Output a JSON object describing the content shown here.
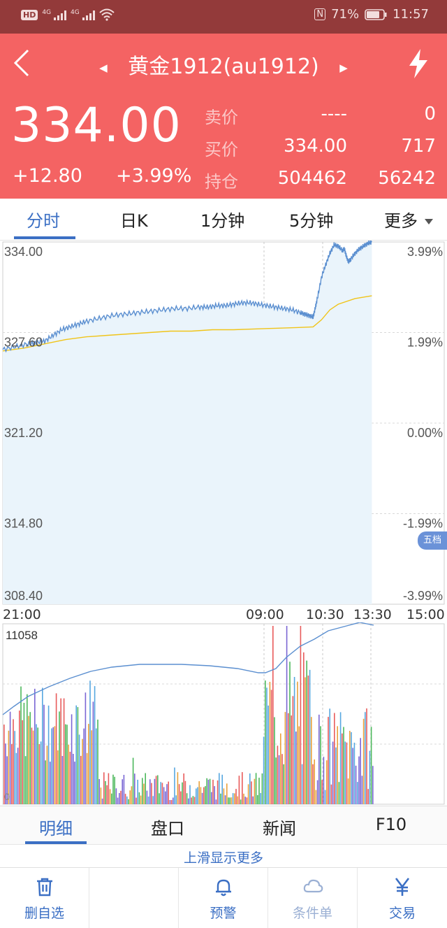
{
  "status_bar": {
    "hd": "HD",
    "net1": "4G",
    "net2": "4G",
    "nfc": "N",
    "battery": "71%",
    "time": "11:57"
  },
  "header": {
    "title": "黄金1912(au1912)",
    "last_price": "334.00",
    "change": "+12.80",
    "change_pct": "+3.99%",
    "quote_rows": [
      {
        "label": "卖价",
        "v1": "----",
        "v2": "0"
      },
      {
        "label": "买价",
        "v1": "334.00",
        "v2": "717"
      },
      {
        "label": "持仓",
        "v1": "504462",
        "v2": "56242"
      }
    ]
  },
  "chart_tabs": [
    {
      "label": "分时",
      "active": true
    },
    {
      "label": "日K",
      "active": false
    },
    {
      "label": "1分钟",
      "active": false
    },
    {
      "label": "5分钟",
      "active": false
    },
    {
      "label": "更多",
      "active": false
    }
  ],
  "five_level_badge": "五档",
  "colors": {
    "header_bg": "#f46363",
    "status_bg": "#933a3a",
    "accent": "#3b6fc4",
    "price_line": "#5b8fd0",
    "avg_line": "#f0c419",
    "fill": "#eaf4fb"
  },
  "chart_data": [
    {
      "type": "line",
      "name": "intraday-price",
      "y_labels_left": [
        "334.00",
        "327.60",
        "321.20",
        "314.80",
        "308.40"
      ],
      "y_labels_right": [
        "3.99%",
        "1.99%",
        "0.00%",
        "-1.99%",
        "-3.99%"
      ],
      "ylim": [
        308.4,
        334.0
      ],
      "time_labels": [
        "21:00",
        "09:00",
        "10:30",
        "13:30",
        "15:00"
      ],
      "x_range_fraction": [
        0,
        0.83
      ],
      "series": [
        {
          "values": [
            326.4,
            326.6,
            326.8,
            326.9,
            327.0,
            327.4,
            327.8,
            328.0,
            328.2,
            328.4,
            328.6,
            328.8,
            328.9,
            329.0,
            329.1,
            329.2,
            329.3,
            329.3,
            329.4,
            329.4,
            329.5,
            329.5,
            329.6,
            329.7,
            329.7,
            329.6,
            329.5,
            329.4,
            329.3,
            329.2,
            329.0,
            328.9,
            328.8,
            328.7,
            329.3,
            330.0,
            331.5,
            332.4,
            333.2,
            333.8,
            333.7,
            333.4,
            333.5,
            332.9,
            332.6,
            332.8,
            333.2,
            333.5,
            333.7,
            333.9,
            334.0
          ],
          "x_fraction": [
            0.0,
            0.03,
            0.06,
            0.08,
            0.1,
            0.12,
            0.14,
            0.16,
            0.18,
            0.2,
            0.23,
            0.26,
            0.29,
            0.32,
            0.35,
            0.38,
            0.41,
            0.44,
            0.47,
            0.49,
            0.51,
            0.53,
            0.55,
            0.57,
            0.59,
            0.61,
            0.63,
            0.65,
            0.67,
            0.69,
            0.71,
            0.72,
            0.73,
            0.74,
            0.745,
            0.75,
            0.76,
            0.77,
            0.78,
            0.79,
            0.8,
            0.81,
            0.815,
            0.82,
            0.825,
            0.83,
            0.84,
            0.85,
            0.86,
            0.87,
            0.88
          ]
        },
        {
          "values": [
            326.3,
            326.5,
            326.8,
            327.1,
            327.3,
            327.4,
            327.5,
            327.6,
            327.7,
            327.7,
            327.8,
            327.8,
            327.85,
            327.9,
            327.95,
            328.0,
            328.5,
            329.2,
            329.6,
            330.0,
            330.2
          ],
          "x_fraction": [
            0.0,
            0.05,
            0.1,
            0.15,
            0.2,
            0.25,
            0.3,
            0.35,
            0.4,
            0.45,
            0.5,
            0.55,
            0.6,
            0.65,
            0.7,
            0.74,
            0.76,
            0.78,
            0.8,
            0.84,
            0.88
          ]
        }
      ]
    },
    {
      "type": "bar",
      "name": "volume",
      "y_label_top": "11058",
      "y_label_bottom": "0"
    }
  ],
  "detail_tabs": [
    {
      "label": "明细",
      "active": true
    },
    {
      "label": "盘口",
      "active": false
    },
    {
      "label": "新闻",
      "active": false
    },
    {
      "label": "F10",
      "active": false
    }
  ],
  "more_hint": "上滑显示更多",
  "bottom_nav": [
    {
      "label": "删自选",
      "icon": "trash-icon",
      "disabled": false
    },
    {
      "label": "",
      "icon": "",
      "disabled": false
    },
    {
      "label": "预警",
      "icon": "bell-icon",
      "disabled": false
    },
    {
      "label": "条件单",
      "icon": "cloud-icon",
      "disabled": true
    },
    {
      "label": "交易",
      "icon": "yen-icon",
      "disabled": false
    }
  ]
}
